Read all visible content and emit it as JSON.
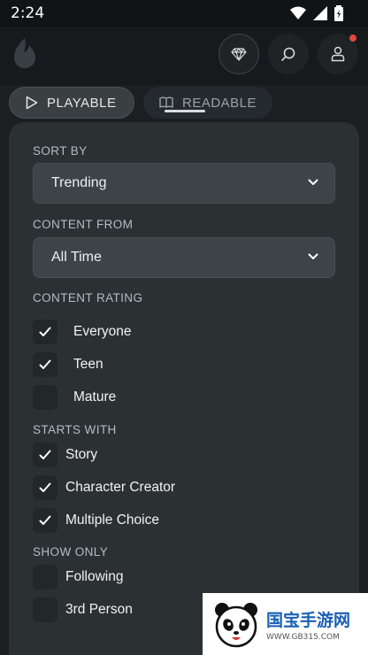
{
  "status_bar": {
    "time": "2:24"
  },
  "header": {
    "logo_icon": "flame-icon",
    "buttons": [
      "gem-icon",
      "search-icon",
      "profile-icon"
    ],
    "notification_color": "#e0483e"
  },
  "tabs": [
    {
      "label": "PLAYABLE",
      "icon": "play-icon",
      "selected": true
    },
    {
      "label": "READABLE",
      "icon": "book-icon",
      "selected": false
    }
  ],
  "filters": {
    "sort_by": {
      "label": "SORT BY",
      "value": "Trending"
    },
    "content_from": {
      "label": "CONTENT FROM",
      "value": "All Time"
    },
    "content_rating": {
      "label": "CONTENT RATING",
      "options": [
        {
          "label": "Everyone",
          "checked": true
        },
        {
          "label": "Teen",
          "checked": true
        },
        {
          "label": "Mature",
          "checked": false
        }
      ]
    },
    "starts_with": {
      "label": "STARTS WITH",
      "options": [
        {
          "label": "Story",
          "checked": true
        },
        {
          "label": "Character Creator",
          "checked": true
        },
        {
          "label": "Multiple Choice",
          "checked": true
        }
      ]
    },
    "show_only": {
      "label": "SHOW ONLY",
      "options": [
        {
          "label": "Following",
          "checked": false
        },
        {
          "label": "3rd Person",
          "checked": false
        }
      ]
    }
  },
  "watermark": {
    "title": "国宝手游网",
    "url": "WWW.GB315.COM"
  }
}
